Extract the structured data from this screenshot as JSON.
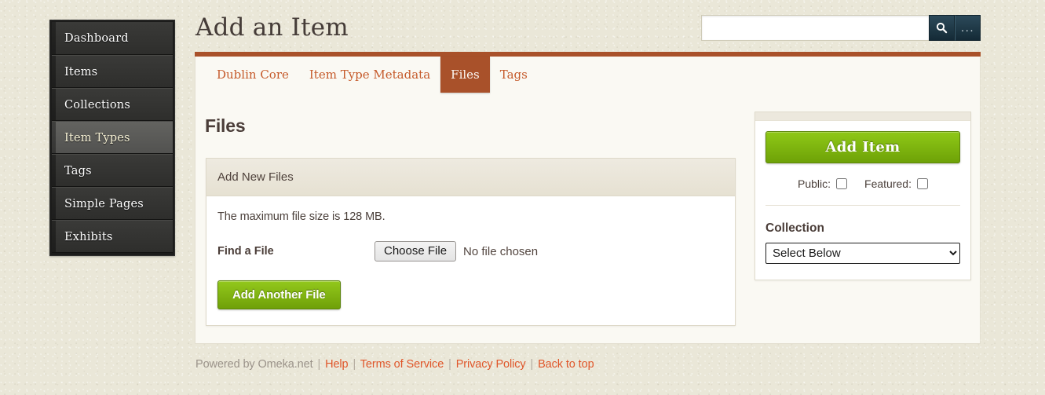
{
  "colors": {
    "page_bg": "#eae7d8",
    "nav_bg": "#1c1c1b",
    "nav_active_text": "#f6f1d5",
    "accent_orange": "#a9512a",
    "tab_link": "#c55a2a",
    "green_button": "#8fc817",
    "search_button": "#1e3a4a",
    "footer_link": "#e0562a",
    "content_bg": "#faf9f3"
  },
  "sidebar": {
    "items": [
      {
        "label": "Dashboard",
        "active": false
      },
      {
        "label": "Items",
        "active": false
      },
      {
        "label": "Collections",
        "active": false
      },
      {
        "label": "Item Types",
        "active": true
      },
      {
        "label": "Tags",
        "active": false
      },
      {
        "label": "Simple Pages",
        "active": false
      },
      {
        "label": "Exhibits",
        "active": false
      }
    ]
  },
  "header": {
    "title": "Add an Item"
  },
  "search": {
    "value": "",
    "placeholder": "",
    "search_icon": "search-icon",
    "advanced_icon": "ellipsis-icon",
    "advanced_label": "..."
  },
  "main": {
    "tabs": [
      {
        "label": "Dublin Core",
        "active": false
      },
      {
        "label": "Item Type Metadata",
        "active": false
      },
      {
        "label": "Files",
        "active": true
      },
      {
        "label": "Tags",
        "active": false
      }
    ],
    "section_title": "Files",
    "files_panel": {
      "header": "Add New Files",
      "max_size_note": "The maximum file size is 128 MB.",
      "find_a_file_label": "Find a File",
      "choose_file_label": "Choose File",
      "no_file_text": "No file chosen",
      "add_another_label": "Add Another File"
    }
  },
  "side_panel": {
    "add_item_label": "Add Item",
    "public_label": "Public:",
    "public_checked": false,
    "featured_label": "Featured:",
    "featured_checked": false,
    "collection_label": "Collection",
    "collection_value": "Select Below",
    "collection_options": [
      "Select Below"
    ]
  },
  "footer": {
    "powered_by": "Powered by Omeka.net",
    "links": [
      "Help",
      "Terms of Service",
      "Privacy Policy",
      "Back to top"
    ],
    "separator": "|"
  }
}
